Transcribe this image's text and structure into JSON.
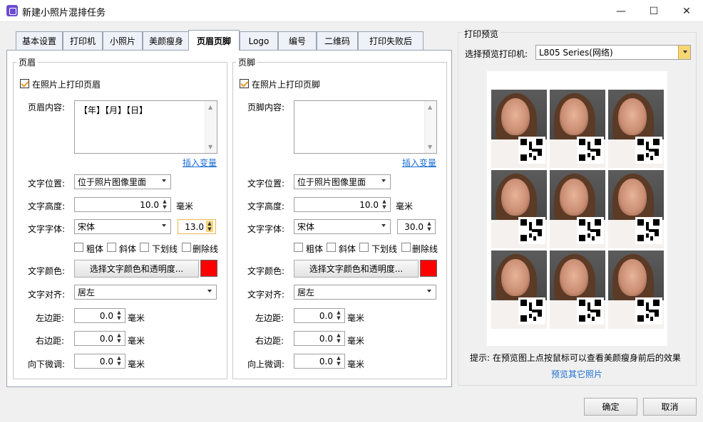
{
  "window": {
    "title": "新建小照片混排任务"
  },
  "tabs": [
    "基本设置",
    "打印机",
    "小照片",
    "美颜瘦身",
    "页眉页脚",
    "Logo",
    "编号",
    "二维码",
    "打印失败后"
  ],
  "header": {
    "group_title": "页眉",
    "print_checkbox": "在照片上打印页眉",
    "content_label": "页眉内容:",
    "content_value": "【年】【月】【日】",
    "insert_var": "插入变量",
    "pos_label": "文字位置:",
    "pos_value": "位于照片图像里面",
    "height_label": "文字高度:",
    "height_value": "10.0",
    "height_unit": "毫米",
    "font_label": "文字字体:",
    "font_value": "宋体",
    "font_size": "13.0",
    "bold": "粗体",
    "italic": "斜体",
    "underline": "下划线",
    "strike": "删除线",
    "color_label": "文字颜色:",
    "color_btn": "选择文字颜色和透明度...",
    "color_value": "#ff0000",
    "align_label": "文字对齐:",
    "align_value": "居左",
    "left_label": "左边距:",
    "left_value": "0.0",
    "right_label": "右边距:",
    "right_value": "0.0",
    "adjust_label": "向下微调:",
    "adjust_value": "0.0",
    "unit": "毫米"
  },
  "footer": {
    "group_title": "页脚",
    "print_checkbox": "在照片上打印页脚",
    "content_label": "页脚内容:",
    "content_value": "",
    "insert_var": "插入变量",
    "pos_label": "文字位置:",
    "pos_value": "位于照片图像里面",
    "height_label": "文字高度:",
    "height_value": "10.0",
    "height_unit": "毫米",
    "font_label": "文字字体:",
    "font_value": "宋体",
    "font_size": "30.0",
    "bold": "粗体",
    "italic": "斜体",
    "underline": "下划线",
    "strike": "删除线",
    "color_label": "文字颜色:",
    "color_btn": "选择文字颜色和透明度...",
    "color_value": "#ff0000",
    "align_label": "文字对齐:",
    "align_value": "居左",
    "left_label": "左边距:",
    "left_value": "0.0",
    "right_label": "右边距:",
    "right_value": "0.0",
    "adjust_label": "向上微调:",
    "adjust_value": "0.0",
    "unit": "毫米"
  },
  "preview": {
    "group_title": "打印预览",
    "printer_label": "选择预览打印机:",
    "printer_value": "L805 Series(网络)",
    "hint": "提示: 在预览图上点按鼠标可以查看美颜瘦身前后的效果",
    "other_link": "预览其它照片"
  },
  "buttons": {
    "ok": "确定",
    "cancel": "取消"
  }
}
